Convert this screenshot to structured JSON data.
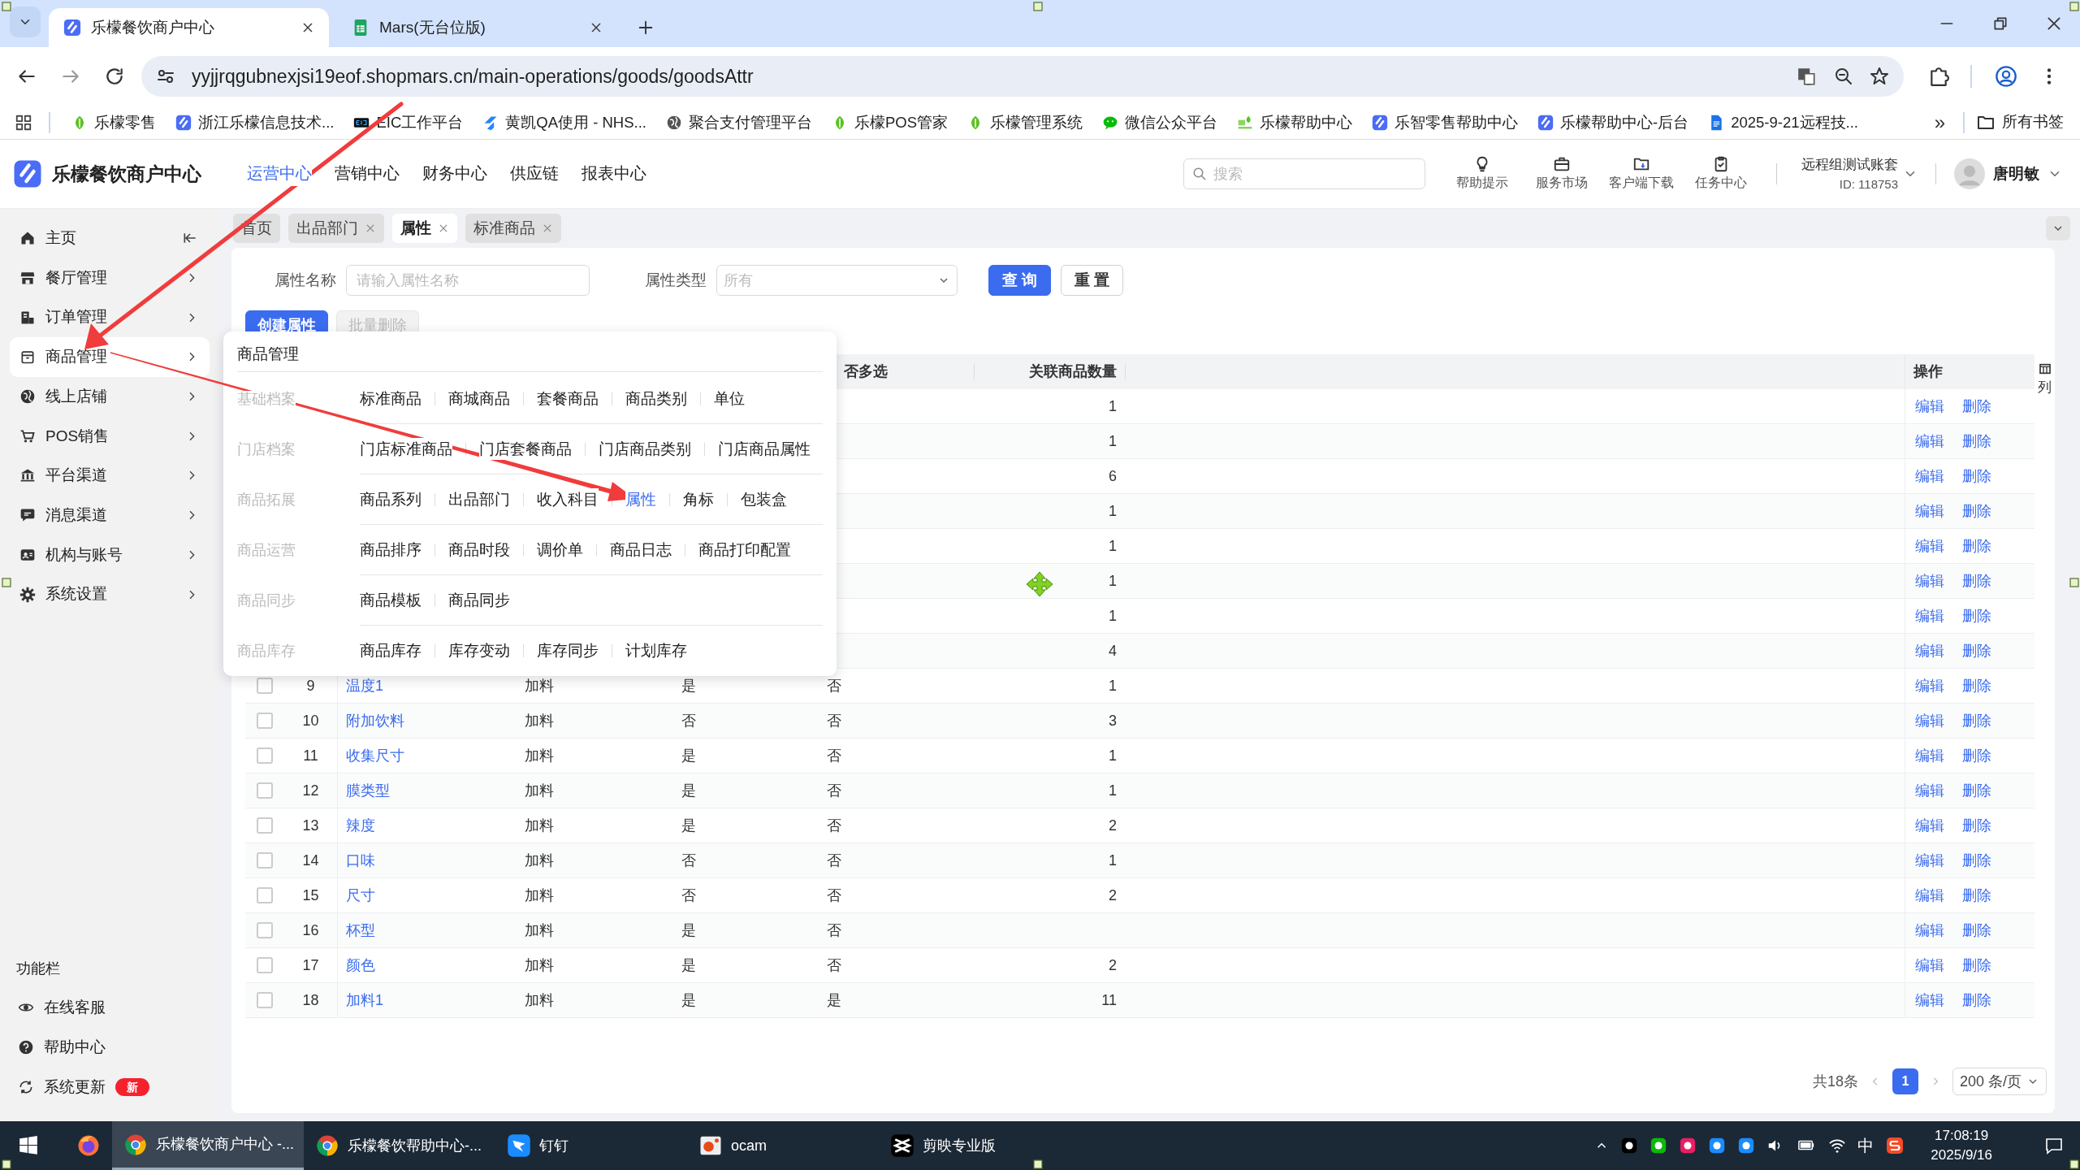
{
  "browser": {
    "tabs": [
      {
        "title": "乐檬餐饮商户中心",
        "selected": true,
        "kind": "app"
      },
      {
        "title": "Mars(无台位版)",
        "selected": false,
        "kind": "sheet"
      }
    ],
    "url": "yyjjrqgubnexjsi19eof.shopmars.cn/main-operations/goods/goodsAttr",
    "bookmarks": [
      {
        "label": "乐檬零售",
        "kind": "leaf"
      },
      {
        "label": "浙江乐檬信息技术...",
        "kind": "app"
      },
      {
        "label": "EIC工作平台",
        "kind": "eic"
      },
      {
        "label": "黄凯QA使用 - NHS...",
        "kind": "jira"
      },
      {
        "label": "聚合支付管理平台",
        "kind": "globe"
      },
      {
        "label": "乐檬POS管家",
        "kind": "leaf"
      },
      {
        "label": "乐檬管理系统",
        "kind": "leaf"
      },
      {
        "label": "微信公众平台",
        "kind": "wechat"
      },
      {
        "label": "乐檬帮助中心",
        "kind": "lemon"
      },
      {
        "label": "乐智零售帮助中心",
        "kind": "app"
      },
      {
        "label": "乐檬帮助中心-后台",
        "kind": "app"
      },
      {
        "label": "2025-9-21远程技...",
        "kind": "doc"
      }
    ],
    "more": "»",
    "all_bookmarks": "所有书签"
  },
  "header": {
    "app_name": "乐檬餐饮商户中心",
    "nav": [
      {
        "label": "运营中心",
        "selected": true
      },
      {
        "label": "营销中心",
        "selected": false
      },
      {
        "label": "财务中心",
        "selected": false
      },
      {
        "label": "供应链",
        "selected": false
      },
      {
        "label": "报表中心",
        "selected": false
      }
    ],
    "search": {
      "placeholder": "搜索"
    },
    "tools": [
      {
        "label": "帮助提示",
        "kind": "bulb"
      },
      {
        "label": "服务市场",
        "kind": "bag"
      },
      {
        "label": "客户端下载",
        "kind": "folder"
      },
      {
        "label": "任务中心",
        "kind": "clipboard"
      }
    ],
    "account": {
      "name": "远程组测试账套",
      "id": "ID: 118753"
    },
    "user": {
      "name": "唐明敏"
    }
  },
  "sidebar": {
    "items": [
      {
        "label": "主页",
        "kind": "home",
        "selected": false
      },
      {
        "label": "餐厅管理",
        "kind": "shop",
        "selected": false
      },
      {
        "label": "订单管理",
        "kind": "order",
        "selected": false
      },
      {
        "label": "商品管理",
        "kind": "goods",
        "selected": true
      },
      {
        "label": "线上店铺",
        "kind": "globe",
        "selected": false
      },
      {
        "label": "POS销售",
        "kind": "cart",
        "selected": false
      },
      {
        "label": "平台渠道",
        "kind": "bank",
        "selected": false
      },
      {
        "label": "消息渠道",
        "kind": "chat",
        "selected": false
      },
      {
        "label": "机构与账号",
        "kind": "id",
        "selected": false
      },
      {
        "label": "系统设置",
        "kind": "gear",
        "selected": false
      }
    ],
    "section_title": "功能栏",
    "utilities": [
      {
        "label": "在线客服",
        "kind": "headset"
      },
      {
        "label": "帮助中心",
        "kind": "help"
      },
      {
        "label": "系统更新",
        "kind": "refresh",
        "badge": "新"
      }
    ]
  },
  "page_tabs": [
    {
      "label": "首页",
      "closable": false,
      "selected": false
    },
    {
      "label": "出品部门",
      "closable": true,
      "selected": false
    },
    {
      "label": "属性",
      "closable": true,
      "selected": true
    },
    {
      "label": "标准商品",
      "closable": true,
      "selected": false
    }
  ],
  "filters": [
    {
      "label": "属性名称",
      "kind": "input",
      "placeholder": "请输入属性名称"
    },
    {
      "label": "属性类型",
      "kind": "select",
      "value": "所有"
    }
  ],
  "filter_buttons": [
    {
      "label": "查 询",
      "kind": "primary"
    },
    {
      "label": "重 置",
      "kind": "default"
    }
  ],
  "actions": [
    {
      "label": "创建属性",
      "kind": "primary"
    },
    {
      "label": "批量删除",
      "kind": "disabled"
    }
  ],
  "table": {
    "headers": {
      "column_6": "否多选",
      "count": "关联商品数量",
      "actions": "操作"
    },
    "column_settings": "列",
    "rows": [
      {
        "count": "1",
        "actions": [
          "编辑",
          "删除"
        ]
      },
      {
        "count": "1",
        "actions": [
          "编辑",
          "删除"
        ]
      },
      {
        "count": "6",
        "actions": [
          "编辑",
          "删除"
        ]
      },
      {
        "count": "1",
        "actions": [
          "编辑",
          "删除"
        ]
      },
      {
        "count": "1",
        "actions": [
          "编辑",
          "删除"
        ]
      },
      {
        "count": "1",
        "actions": [
          "编辑",
          "删除"
        ]
      },
      {
        "count": "1",
        "actions": [
          "编辑",
          "删除"
        ]
      },
      {
        "count": "4",
        "actions": [
          "编辑",
          "删除"
        ]
      },
      {
        "checked": false,
        "index": "9",
        "column_3": "温度1",
        "column_4": "加料",
        "column_5": "是",
        "column_6": "否",
        "count": "1",
        "actions": [
          "编辑",
          "删除"
        ]
      },
      {
        "checked": false,
        "index": "10",
        "column_3": "附加饮料",
        "column_4": "加料",
        "column_5": "否",
        "column_6": "否",
        "count": "3",
        "actions": [
          "编辑",
          "删除"
        ]
      },
      {
        "checked": false,
        "index": "11",
        "column_3": "收集尺寸",
        "column_4": "加料",
        "column_5": "是",
        "column_6": "否",
        "count": "1",
        "actions": [
          "编辑",
          "删除"
        ]
      },
      {
        "checked": false,
        "index": "12",
        "column_3": "膜类型",
        "column_4": "加料",
        "column_5": "是",
        "column_6": "否",
        "count": "1",
        "actions": [
          "编辑",
          "删除"
        ]
      },
      {
        "checked": false,
        "index": "13",
        "column_3": "辣度",
        "column_4": "加料",
        "column_5": "是",
        "column_6": "否",
        "count": "2",
        "actions": [
          "编辑",
          "删除"
        ]
      },
      {
        "checked": false,
        "index": "14",
        "column_3": "口味",
        "column_4": "加料",
        "column_5": "否",
        "column_6": "否",
        "count": "1",
        "actions": [
          "编辑",
          "删除"
        ]
      },
      {
        "checked": false,
        "index": "15",
        "column_3": "尺寸",
        "column_4": "加料",
        "column_5": "否",
        "column_6": "否",
        "count": "2",
        "actions": [
          "编辑",
          "删除"
        ]
      },
      {
        "checked": false,
        "index": "16",
        "column_3": "杯型",
        "column_4": "加料",
        "column_5": "是",
        "column_6": "否",
        "actions": [
          "编辑",
          "删除"
        ]
      },
      {
        "checked": false,
        "index": "17",
        "column_3": "颜色",
        "column_4": "加料",
        "column_5": "是",
        "column_6": "否",
        "count": "2",
        "actions": [
          "编辑",
          "删除"
        ]
      },
      {
        "checked": false,
        "index": "18",
        "column_3": "加料1",
        "column_4": "加料",
        "column_5": "是",
        "column_6": "是",
        "count": "11",
        "actions": [
          "编辑",
          "删除"
        ]
      }
    ]
  },
  "pagination": {
    "total": "共18条",
    "pages": [
      {
        "label": "1",
        "selected": true
      }
    ],
    "page_size": "200 条/页"
  },
  "menu": {
    "title": "商品管理",
    "groups": [
      {
        "label": "基础档案",
        "items": [
          {
            "label": "标准商品",
            "selected": false
          },
          {
            "label": "商城商品",
            "selected": false
          },
          {
            "label": "套餐商品",
            "selected": false
          },
          {
            "label": "商品类别",
            "selected": false
          },
          {
            "label": "单位",
            "selected": false
          }
        ]
      },
      {
        "label": "门店档案",
        "items": [
          {
            "label": "门店标准商品",
            "selected": false
          },
          {
            "label": "门店套餐商品",
            "selected": false
          },
          {
            "label": "门店商品类别",
            "selected": false
          },
          {
            "label": "门店商品属性",
            "selected": false
          }
        ]
      },
      {
        "label": "商品拓展",
        "items": [
          {
            "label": "商品系列",
            "selected": false
          },
          {
            "label": "出品部门",
            "selected": false
          },
          {
            "label": "收入科目",
            "selected": false
          },
          {
            "label": "属性",
            "selected": true
          },
          {
            "label": "角标",
            "selected": false
          },
          {
            "label": "包装盒",
            "selected": false
          }
        ]
      },
      {
        "label": "商品运营",
        "items": [
          {
            "label": "商品排序",
            "selected": false
          },
          {
            "label": "商品时段",
            "selected": false
          },
          {
            "label": "调价单",
            "selected": false
          },
          {
            "label": "商品日志",
            "selected": false
          },
          {
            "label": "商品打印配置",
            "selected": false
          }
        ]
      },
      {
        "label": "商品同步",
        "items": [
          {
            "label": "商品模板",
            "selected": false
          },
          {
            "label": "商品同步",
            "selected": false
          }
        ]
      },
      {
        "label": "商品库存",
        "items": [
          {
            "label": "商品库存",
            "selected": false
          },
          {
            "label": "库存变动",
            "selected": false
          },
          {
            "label": "库存同步",
            "selected": false
          },
          {
            "label": "计划库存",
            "selected": false
          }
        ]
      }
    ]
  },
  "taskbar": {
    "items": [
      {
        "kind": "firefox",
        "selected": false
      },
      {
        "kind": "chrome",
        "label": "乐檬餐饮商户中心 -...",
        "selected": true
      },
      {
        "kind": "chrome",
        "label": "乐檬餐饮帮助中心-...",
        "selected": false
      },
      {
        "kind": "dingtalk",
        "label": "钉钉",
        "selected": false
      },
      {
        "kind": "ocam",
        "label": "ocam",
        "selected": false
      },
      {
        "kind": "capcut",
        "label": "剪映专业版",
        "selected": false
      }
    ],
    "ime": "中",
    "time": "17:08:19",
    "date": "2025/9/16"
  }
}
